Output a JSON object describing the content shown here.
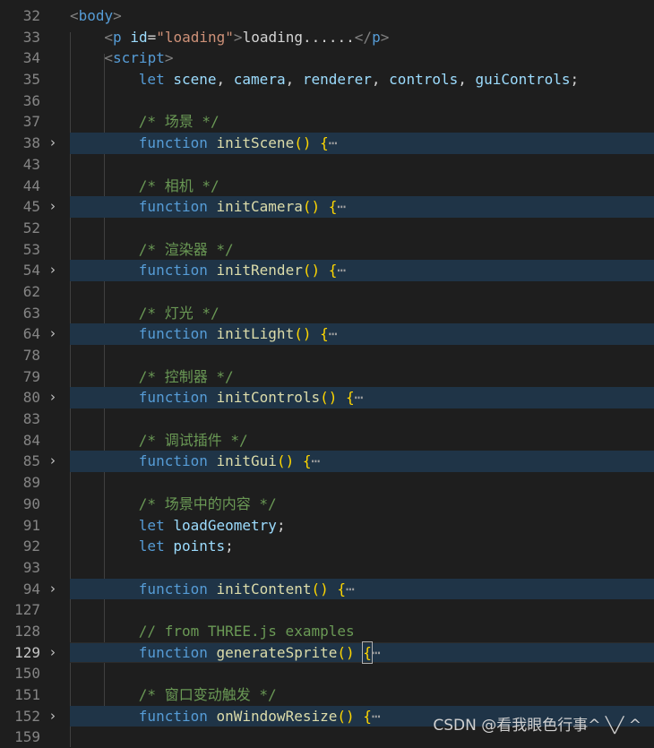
{
  "editor": {
    "lines": [
      {
        "num": "32",
        "indent": 0,
        "tokens": [
          [
            "t-punc",
            "<"
          ],
          [
            "t-tag",
            "body"
          ],
          [
            "t-punc",
            ">"
          ]
        ]
      },
      {
        "num": "33",
        "indent": 1,
        "tokens": [
          [
            "t-punc",
            "<"
          ],
          [
            "t-tag",
            "p"
          ],
          [
            "t-plain",
            " "
          ],
          [
            "t-attr",
            "id"
          ],
          [
            "t-plain",
            "="
          ],
          [
            "t-str",
            "\"loading\""
          ],
          [
            "t-punc",
            ">"
          ],
          [
            "t-text",
            "loading......"
          ],
          [
            "t-punc",
            "</"
          ],
          [
            "t-tag",
            "p"
          ],
          [
            "t-punc",
            ">"
          ]
        ]
      },
      {
        "num": "34",
        "indent": 1,
        "tokens": [
          [
            "t-punc",
            "<"
          ],
          [
            "t-tag",
            "script"
          ],
          [
            "t-punc",
            ">"
          ]
        ]
      },
      {
        "num": "35",
        "indent": 2,
        "tokens": [
          [
            "t-kw",
            "let"
          ],
          [
            "t-plain",
            " "
          ],
          [
            "t-var",
            "scene"
          ],
          [
            "t-plain",
            ", "
          ],
          [
            "t-var",
            "camera"
          ],
          [
            "t-plain",
            ", "
          ],
          [
            "t-var",
            "renderer"
          ],
          [
            "t-plain",
            ", "
          ],
          [
            "t-var",
            "controls"
          ],
          [
            "t-plain",
            ", "
          ],
          [
            "t-var",
            "guiControls"
          ],
          [
            "t-plain",
            ";"
          ]
        ]
      },
      {
        "num": "36",
        "indent": 0,
        "tokens": []
      },
      {
        "num": "37",
        "indent": 2,
        "tokens": [
          [
            "t-com",
            "/* 场景 */"
          ]
        ]
      },
      {
        "num": "38",
        "indent": 2,
        "folded": true,
        "tokens": [
          [
            "t-kw",
            "function"
          ],
          [
            "t-plain",
            " "
          ],
          [
            "t-fn",
            "initScene"
          ],
          [
            "t-brace",
            "()"
          ],
          [
            "t-plain",
            " "
          ],
          [
            "t-brace",
            "{"
          ],
          [
            "t-ell",
            "⋯"
          ]
        ]
      },
      {
        "num": "43",
        "indent": 0,
        "tokens": []
      },
      {
        "num": "44",
        "indent": 2,
        "tokens": [
          [
            "t-com",
            "/* 相机 */"
          ]
        ]
      },
      {
        "num": "45",
        "indent": 2,
        "folded": true,
        "tokens": [
          [
            "t-kw",
            "function"
          ],
          [
            "t-plain",
            " "
          ],
          [
            "t-fn",
            "initCamera"
          ],
          [
            "t-brace",
            "()"
          ],
          [
            "t-plain",
            " "
          ],
          [
            "t-brace",
            "{"
          ],
          [
            "t-ell",
            "⋯"
          ]
        ]
      },
      {
        "num": "52",
        "indent": 0,
        "tokens": []
      },
      {
        "num": "53",
        "indent": 2,
        "tokens": [
          [
            "t-com",
            "/* 渲染器 */"
          ]
        ]
      },
      {
        "num": "54",
        "indent": 2,
        "folded": true,
        "tokens": [
          [
            "t-kw",
            "function"
          ],
          [
            "t-plain",
            " "
          ],
          [
            "t-fn",
            "initRender"
          ],
          [
            "t-brace",
            "()"
          ],
          [
            "t-plain",
            " "
          ],
          [
            "t-brace",
            "{"
          ],
          [
            "t-ell",
            "⋯"
          ]
        ]
      },
      {
        "num": "62",
        "indent": 0,
        "tokens": []
      },
      {
        "num": "63",
        "indent": 2,
        "tokens": [
          [
            "t-com",
            "/* 灯光 */"
          ]
        ]
      },
      {
        "num": "64",
        "indent": 2,
        "folded": true,
        "tokens": [
          [
            "t-kw",
            "function"
          ],
          [
            "t-plain",
            " "
          ],
          [
            "t-fn",
            "initLight"
          ],
          [
            "t-brace",
            "()"
          ],
          [
            "t-plain",
            " "
          ],
          [
            "t-brace",
            "{"
          ],
          [
            "t-ell",
            "⋯"
          ]
        ]
      },
      {
        "num": "78",
        "indent": 0,
        "tokens": []
      },
      {
        "num": "79",
        "indent": 2,
        "tokens": [
          [
            "t-com",
            "/* 控制器 */"
          ]
        ]
      },
      {
        "num": "80",
        "indent": 2,
        "folded": true,
        "tokens": [
          [
            "t-kw",
            "function"
          ],
          [
            "t-plain",
            " "
          ],
          [
            "t-fn",
            "initControls"
          ],
          [
            "t-brace",
            "()"
          ],
          [
            "t-plain",
            " "
          ],
          [
            "t-brace",
            "{"
          ],
          [
            "t-ell",
            "⋯"
          ]
        ]
      },
      {
        "num": "83",
        "indent": 0,
        "tokens": []
      },
      {
        "num": "84",
        "indent": 2,
        "tokens": [
          [
            "t-com",
            "/* 调试插件 */"
          ]
        ]
      },
      {
        "num": "85",
        "indent": 2,
        "folded": true,
        "tokens": [
          [
            "t-kw",
            "function"
          ],
          [
            "t-plain",
            " "
          ],
          [
            "t-fn",
            "initGui"
          ],
          [
            "t-brace",
            "()"
          ],
          [
            "t-plain",
            " "
          ],
          [
            "t-brace",
            "{"
          ],
          [
            "t-ell",
            "⋯"
          ]
        ]
      },
      {
        "num": "89",
        "indent": 0,
        "tokens": []
      },
      {
        "num": "90",
        "indent": 2,
        "tokens": [
          [
            "t-com",
            "/* 场景中的内容 */"
          ]
        ]
      },
      {
        "num": "91",
        "indent": 2,
        "tokens": [
          [
            "t-kw",
            "let"
          ],
          [
            "t-plain",
            " "
          ],
          [
            "t-var",
            "loadGeometry"
          ],
          [
            "t-plain",
            ";"
          ]
        ]
      },
      {
        "num": "92",
        "indent": 2,
        "tokens": [
          [
            "t-kw",
            "let"
          ],
          [
            "t-plain",
            " "
          ],
          [
            "t-var",
            "points"
          ],
          [
            "t-plain",
            ";"
          ]
        ]
      },
      {
        "num": "93",
        "indent": 0,
        "tokens": []
      },
      {
        "num": "94",
        "indent": 2,
        "folded": true,
        "tokens": [
          [
            "t-kw",
            "function"
          ],
          [
            "t-plain",
            " "
          ],
          [
            "t-fn",
            "initContent"
          ],
          [
            "t-brace",
            "()"
          ],
          [
            "t-plain",
            " "
          ],
          [
            "t-brace",
            "{"
          ],
          [
            "t-ell",
            "⋯"
          ]
        ]
      },
      {
        "num": "127",
        "indent": 0,
        "tokens": []
      },
      {
        "num": "128",
        "indent": 2,
        "tokens": [
          [
            "t-com",
            "// from THREE.js examples"
          ]
        ]
      },
      {
        "num": "129",
        "indent": 2,
        "folded": true,
        "current": true,
        "tokens": [
          [
            "t-kw",
            "function"
          ],
          [
            "t-plain",
            " "
          ],
          [
            "t-fn",
            "generateSprite"
          ],
          [
            "t-brace",
            "()"
          ],
          [
            "t-plain",
            " "
          ],
          [
            "t-brace caret",
            "{"
          ],
          [
            "t-ell",
            "⋯"
          ]
        ]
      },
      {
        "num": "150",
        "indent": 0,
        "tokens": []
      },
      {
        "num": "151",
        "indent": 2,
        "tokens": [
          [
            "t-com",
            "/* 窗口变动触发 */"
          ]
        ]
      },
      {
        "num": "152",
        "indent": 2,
        "folded": true,
        "tokens": [
          [
            "t-kw",
            "function"
          ],
          [
            "t-plain",
            " "
          ],
          [
            "t-fn",
            "onWindowResize"
          ],
          [
            "t-brace",
            "()"
          ],
          [
            "t-plain",
            " "
          ],
          [
            "t-brace",
            "{"
          ],
          [
            "t-ell",
            "⋯"
          ]
        ]
      },
      {
        "num": "159",
        "indent": 0,
        "tokens": []
      }
    ],
    "fold_icon": "chevron-right-icon",
    "fold_glyph": "›"
  },
  "watermark": {
    "text": "CSDN @看我眼色行事^ ╲╱ ^"
  }
}
